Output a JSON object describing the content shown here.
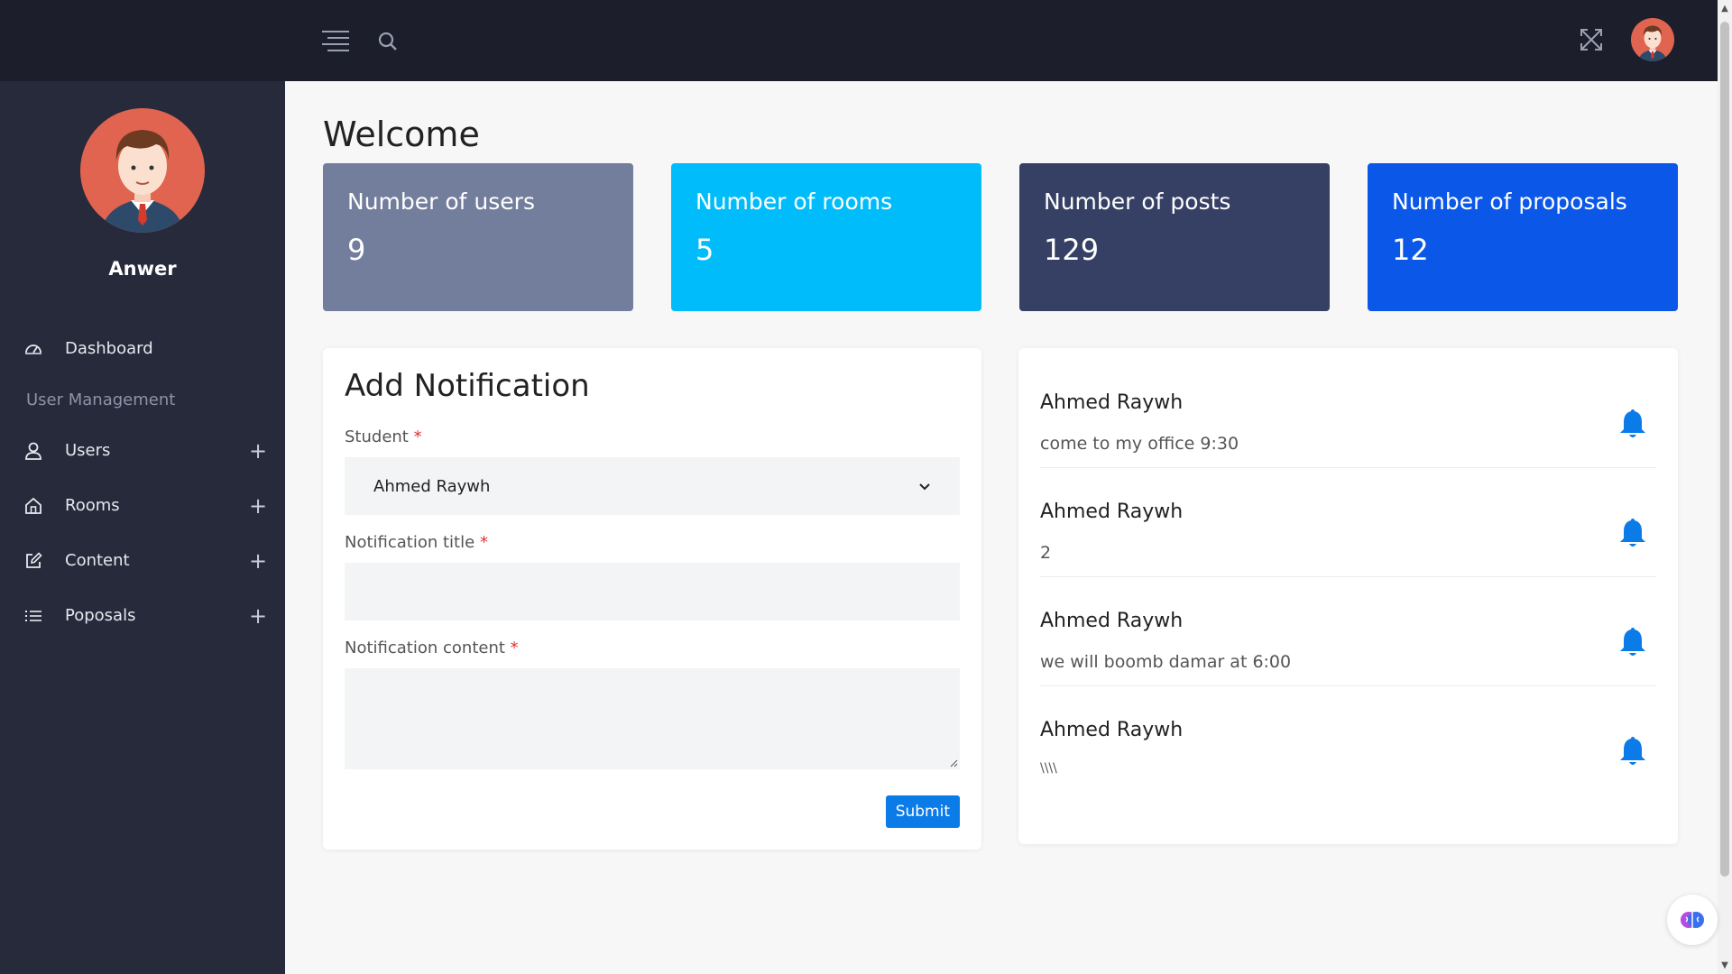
{
  "profile": {
    "name": "Anwer"
  },
  "sidebar": {
    "items": [
      {
        "label": "Dashboard",
        "icon": "gauge-icon",
        "expandable": false
      },
      {
        "label": "User Management",
        "type": "heading"
      },
      {
        "label": "Users",
        "icon": "user-icon",
        "expandable": true
      },
      {
        "label": "Rooms",
        "icon": "home-icon",
        "expandable": true
      },
      {
        "label": "Content",
        "icon": "edit-icon",
        "expandable": true
      },
      {
        "label": "Poposals",
        "icon": "list-icon",
        "expandable": true
      }
    ],
    "expand_symbol": "+"
  },
  "main": {
    "title": "Welcome",
    "stats": [
      {
        "label": "Number of users",
        "value": "9",
        "color": "#737d9c"
      },
      {
        "label": "Number of rooms",
        "value": "5",
        "color": "#00bcfb"
      },
      {
        "label": "Number of posts",
        "value": "129",
        "color": "#364064"
      },
      {
        "label": "Number of proposals",
        "value": "12",
        "color": "#0b57e8"
      }
    ]
  },
  "form": {
    "title": "Add Notification",
    "student_label": "Student",
    "student_value": "Ahmed Raywh",
    "title_label": "Notification title",
    "content_label": "Notification content",
    "required_mark": "*",
    "submit_label": "Submit"
  },
  "notifications": [
    {
      "name": "Ahmed Raywh",
      "text": "come to my office 9:30"
    },
    {
      "name": "Ahmed Raywh",
      "text": "2"
    },
    {
      "name": "Ahmed Raywh",
      "text": "we will boomb damar at 6:00"
    },
    {
      "name": "Ahmed Raywh",
      "text": "\\\\\\\\"
    }
  ],
  "colors": {
    "sidebar": "#262a3b",
    "topbar": "#1c1e2b",
    "accent": "#0b7be8"
  }
}
